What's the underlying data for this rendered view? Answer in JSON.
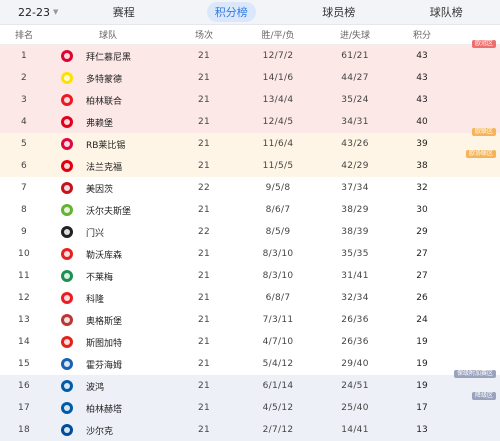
{
  "season": {
    "label": "22-23",
    "chevron": "chevron-down-icon"
  },
  "tabs": [
    {
      "label": "赛程",
      "active": false
    },
    {
      "label": "积分榜",
      "active": true
    },
    {
      "label": "球员榜",
      "active": false
    },
    {
      "label": "球队榜",
      "active": false
    }
  ],
  "headers": {
    "rank": "排名",
    "team": "球队",
    "played": "场次",
    "wdl": "胜/平/负",
    "goals": "进/失球",
    "points": "积分"
  },
  "badges": {
    "ucl": "欧冠区",
    "uel": "欧联区",
    "uecl": "欧协联区",
    "relegation_playoff": "保级附加赛区",
    "relegation": "降级区"
  },
  "teams": [
    {
      "rank": "1",
      "name": "拜仁慕尼黑",
      "played": "21",
      "wdl": "12/7/2",
      "goals": "61/21",
      "points": "43",
      "logo": "bayern-logo-icon",
      "color": "#dc052d"
    },
    {
      "rank": "2",
      "name": "多特蒙德",
      "played": "21",
      "wdl": "14/1/6",
      "goals": "44/27",
      "points": "43",
      "logo": "dortmund-logo-icon",
      "color": "#fde100"
    },
    {
      "rank": "3",
      "name": "柏林联合",
      "played": "21",
      "wdl": "13/4/4",
      "goals": "35/24",
      "points": "43",
      "logo": "union-berlin-logo-icon",
      "color": "#eb1923"
    },
    {
      "rank": "4",
      "name": "弗赖堡",
      "played": "21",
      "wdl": "12/4/5",
      "goals": "34/31",
      "points": "40",
      "logo": "freiburg-logo-icon",
      "color": "#e2001a"
    },
    {
      "rank": "5",
      "name": "RB莱比锡",
      "played": "21",
      "wdl": "11/6/4",
      "goals": "43/26",
      "points": "39",
      "logo": "leipzig-logo-icon",
      "color": "#dd0741"
    },
    {
      "rank": "6",
      "name": "法兰克福",
      "played": "21",
      "wdl": "11/5/5",
      "goals": "42/29",
      "points": "38",
      "logo": "frankfurt-logo-icon",
      "color": "#e1000f"
    },
    {
      "rank": "7",
      "name": "美因茨",
      "played": "22",
      "wdl": "9/5/8",
      "goals": "37/34",
      "points": "32",
      "logo": "mainz-logo-icon",
      "color": "#c3141e"
    },
    {
      "rank": "8",
      "name": "沃尔夫斯堡",
      "played": "21",
      "wdl": "8/6/7",
      "goals": "38/29",
      "points": "30",
      "logo": "wolfsburg-logo-icon",
      "color": "#65b32e"
    },
    {
      "rank": "9",
      "name": "门兴",
      "played": "22",
      "wdl": "8/5/9",
      "goals": "38/39",
      "points": "29",
      "logo": "gladbach-logo-icon",
      "color": "#222222"
    },
    {
      "rank": "10",
      "name": "勒沃库森",
      "played": "21",
      "wdl": "8/3/10",
      "goals": "35/35",
      "points": "27",
      "logo": "leverkusen-logo-icon",
      "color": "#e32221"
    },
    {
      "rank": "11",
      "name": "不莱梅",
      "played": "21",
      "wdl": "8/3/10",
      "goals": "31/41",
      "points": "27",
      "logo": "bremen-logo-icon",
      "color": "#1d9053"
    },
    {
      "rank": "12",
      "name": "科隆",
      "played": "21",
      "wdl": "6/8/7",
      "goals": "32/34",
      "points": "26",
      "logo": "koln-logo-icon",
      "color": "#ed1c24"
    },
    {
      "rank": "13",
      "name": "奥格斯堡",
      "played": "21",
      "wdl": "7/3/11",
      "goals": "26/36",
      "points": "24",
      "logo": "augsburg-logo-icon",
      "color": "#ba3733"
    },
    {
      "rank": "14",
      "name": "斯图加特",
      "played": "21",
      "wdl": "4/7/10",
      "goals": "26/36",
      "points": "19",
      "logo": "stuttgart-logo-icon",
      "color": "#e32219"
    },
    {
      "rank": "15",
      "name": "霍芬海姆",
      "played": "21",
      "wdl": "5/4/12",
      "goals": "29/40",
      "points": "19",
      "logo": "hoffenheim-logo-icon",
      "color": "#1961b5"
    },
    {
      "rank": "16",
      "name": "波鸿",
      "played": "21",
      "wdl": "6/1/14",
      "goals": "24/51",
      "points": "19",
      "logo": "bochum-logo-icon",
      "color": "#005ca9"
    },
    {
      "rank": "17",
      "name": "柏林赫塔",
      "played": "21",
      "wdl": "4/5/12",
      "goals": "25/40",
      "points": "17",
      "logo": "hertha-logo-icon",
      "color": "#005ca9"
    },
    {
      "rank": "18",
      "name": "沙尔克",
      "played": "21",
      "wdl": "2/7/12",
      "goals": "14/41",
      "points": "13",
      "logo": "schalke-logo-icon",
      "color": "#004d9d"
    }
  ]
}
